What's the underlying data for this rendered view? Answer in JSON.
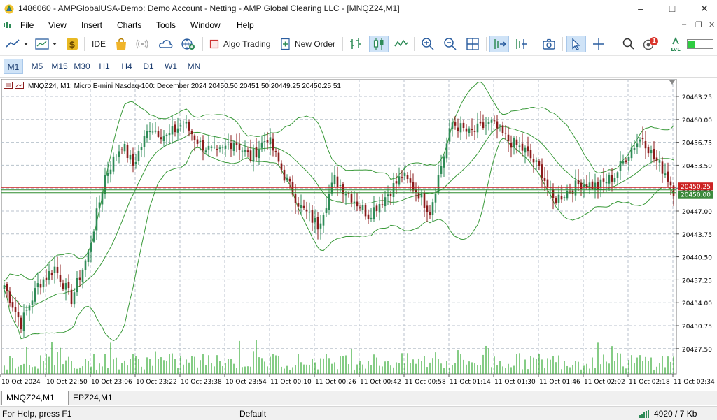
{
  "window": {
    "title": "1486060 - AMPGlobalUSA-Demo: Demo Account - Netting - AMP Global Clearing LLC - [MNQZ24,M1]",
    "minimize": "–",
    "maximize": "□",
    "close": "✕"
  },
  "menu": {
    "items": [
      "File",
      "View",
      "Insert",
      "Charts",
      "Tools",
      "Window",
      "Help"
    ],
    "mdi_minimize": "–",
    "mdi_restore": "❐",
    "mdi_close": "✕"
  },
  "toolbar": {
    "ide_label": "IDE",
    "algo_trading_label": "Algo Trading",
    "new_order_label": "New Order",
    "notification_count": "1"
  },
  "timeframes": {
    "items": [
      "M1",
      "M5",
      "M15",
      "M30",
      "H1",
      "H4",
      "D1",
      "W1",
      "MN"
    ],
    "active": "M1"
  },
  "chart": {
    "header": "MNQZ24, M1:  Micro E-mini Nasdaq-100: December 2024  20450.50  20451.50  20449.25  20450.25  51",
    "price_labels": [
      "20463.25",
      "20460.00",
      "20456.75",
      "20453.50",
      "20450.25",
      "20447.00",
      "20443.75",
      "20440.50",
      "20437.25",
      "20434.00",
      "20430.75",
      "20427.50"
    ],
    "time_labels": [
      "10 Oct 2024",
      "10 Oct 22:50",
      "10 Oct 23:06",
      "10 Oct 23:22",
      "10 Oct 23:38",
      "10 Oct 23:54",
      "11 Oct 00:10",
      "11 Oct 00:26",
      "11 Oct 00:42",
      "11 Oct 00:58",
      "11 Oct 01:14",
      "11 Oct 01:30",
      "11 Oct 01:46",
      "11 Oct 02:02",
      "11 Oct 02:18",
      "11 Oct 02:34"
    ],
    "bid_label": "20450.00",
    "ask_label": "20450.25",
    "colors": {
      "bull": "#2e8b57",
      "bear": "#8b1a1a",
      "bands": "#3a9a3a",
      "grid": "#b8c2cc",
      "bid_line": "#2e8b2e",
      "ask_line": "#cc2222",
      "volume": "#33aa33"
    }
  },
  "chart_data": {
    "type": "candlestick",
    "symbol": "MNQZ24",
    "timeframe": "M1",
    "ylim": [
      20426.0,
      20465.0
    ],
    "anchors": [
      [
        0,
        20436.5
      ],
      [
        6,
        20431.0
      ],
      [
        12,
        20436.5
      ],
      [
        18,
        20439.0
      ],
      [
        24,
        20434.5
      ],
      [
        30,
        20441.0
      ],
      [
        36,
        20452.0
      ],
      [
        42,
        20456.5
      ],
      [
        46,
        20453.5
      ],
      [
        52,
        20459.0
      ],
      [
        58,
        20457.5
      ],
      [
        64,
        20459.5
      ],
      [
        70,
        20456.5
      ],
      [
        76,
        20455.0
      ],
      [
        82,
        20457.0
      ],
      [
        88,
        20454.5
      ],
      [
        94,
        20457.5
      ],
      [
        100,
        20452.0
      ],
      [
        106,
        20447.5
      ],
      [
        112,
        20445.0
      ],
      [
        118,
        20451.5
      ],
      [
        124,
        20449.0
      ],
      [
        130,
        20446.5
      ],
      [
        136,
        20449.0
      ],
      [
        142,
        20452.0
      ],
      [
        148,
        20449.5
      ],
      [
        152,
        20447.0
      ],
      [
        156,
        20453.5
      ],
      [
        160,
        20459.5
      ],
      [
        166,
        20458.0
      ],
      [
        174,
        20459.5
      ],
      [
        180,
        20457.0
      ],
      [
        186,
        20455.5
      ],
      [
        192,
        20452.5
      ],
      [
        196,
        20448.5
      ],
      [
        200,
        20449.5
      ],
      [
        206,
        20451.0
      ],
      [
        212,
        20450.5
      ],
      [
        218,
        20452.0
      ],
      [
        224,
        20456.0
      ],
      [
        228,
        20457.5
      ],
      [
        232,
        20454.5
      ],
      [
        236,
        20452.5
      ],
      [
        239,
        20450.0
      ]
    ]
  },
  "tabs": {
    "items": [
      "MNQZ24,M1",
      "EPZ24,M1"
    ],
    "active": "MNQZ24,M1"
  },
  "status": {
    "help": "For Help, press F1",
    "profile": "Default",
    "traffic": "4920 / 7 Kb"
  }
}
